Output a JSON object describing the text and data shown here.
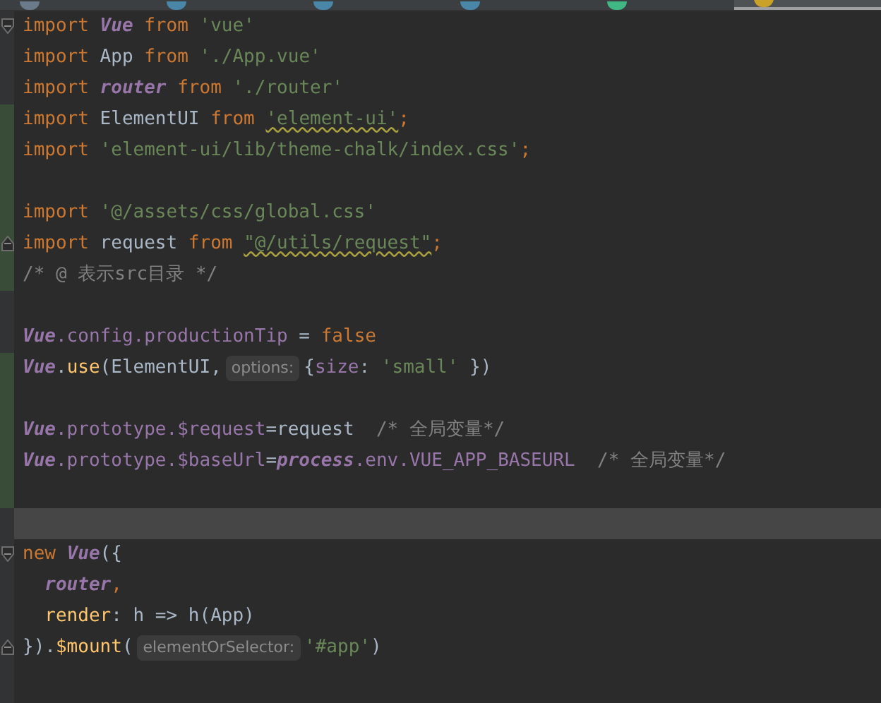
{
  "tabs": [
    {
      "kind": "file",
      "selected": false
    },
    {
      "kind": "java",
      "selected": false
    },
    {
      "kind": "java",
      "selected": false
    },
    {
      "kind": "java",
      "selected": false
    },
    {
      "kind": "vue",
      "selected": false
    },
    {
      "kind": "js",
      "selected": true
    }
  ],
  "lines": [
    {
      "kind": "fold-start",
      "changed": false,
      "current": false,
      "segs": [
        {
          "tokens": [
            {
              "t": "import ",
              "kind": "kw"
            },
            {
              "t": "Vue",
              "kind": "cls"
            },
            {
              "t": " from ",
              "kind": "kw"
            },
            {
              "t": "'vue'",
              "kind": "str"
            }
          ]
        }
      ]
    },
    {
      "kind": "plain",
      "changed": false,
      "current": false,
      "segs": [
        {
          "tokens": [
            {
              "t": "import ",
              "kind": "kw"
            },
            {
              "t": "App",
              "kind": "id"
            },
            {
              "t": " from ",
              "kind": "kw"
            },
            {
              "t": "'./App.vue'",
              "kind": "str"
            }
          ]
        }
      ]
    },
    {
      "kind": "plain",
      "changed": false,
      "current": false,
      "segs": [
        {
          "tokens": [
            {
              "t": "import ",
              "kind": "kw"
            },
            {
              "t": "router",
              "kind": "cls"
            },
            {
              "t": " from ",
              "kind": "kw"
            },
            {
              "t": "'./router'",
              "kind": "str"
            }
          ]
        }
      ]
    },
    {
      "kind": "plain",
      "changed": true,
      "current": false,
      "segs": [
        {
          "tokens": [
            {
              "t": "import ",
              "kind": "kw"
            },
            {
              "t": "ElementUI",
              "kind": "id"
            },
            {
              "t": " from ",
              "kind": "kw"
            },
            {
              "t": "'element-ui'",
              "kind": "warn"
            },
            {
              "t": ";",
              "kind": "kw"
            }
          ]
        }
      ]
    },
    {
      "kind": "plain",
      "changed": true,
      "current": false,
      "segs": [
        {
          "tokens": [
            {
              "t": "import ",
              "kind": "kw"
            },
            {
              "t": "'element-ui/lib/theme-chalk/index.css'",
              "kind": "str"
            },
            {
              "t": ";",
              "kind": "kw"
            }
          ]
        }
      ]
    },
    {
      "kind": "plain",
      "changed": true,
      "current": false
    },
    {
      "kind": "plain",
      "changed": true,
      "current": false,
      "segs": [
        {
          "tokens": [
            {
              "t": "import ",
              "kind": "kw"
            },
            {
              "t": "'@/assets/css/global.css'",
              "kind": "str"
            }
          ]
        }
      ]
    },
    {
      "kind": "fold-end",
      "changed": true,
      "current": false,
      "segs": [
        {
          "tokens": [
            {
              "t": "import ",
              "kind": "kw"
            },
            {
              "t": "request",
              "kind": "id"
            },
            {
              "t": " from ",
              "kind": "kw"
            },
            {
              "t": "\"@/utils/request\"",
              "kind": "warn"
            },
            {
              "t": ";",
              "kind": "kw"
            }
          ]
        }
      ]
    },
    {
      "kind": "plain",
      "changed": true,
      "current": false,
      "segs": [
        {
          "tokens": [
            {
              "t": "/* @ 表示src目录 */",
              "kind": "cmt"
            }
          ]
        }
      ]
    },
    {
      "kind": "plain",
      "changed": false,
      "current": false
    },
    {
      "kind": "plain",
      "changed": false,
      "current": false,
      "segs": [
        {
          "tokens": [
            {
              "t": "Vue",
              "kind": "cls"
            },
            {
              "t": ".config.productionTip",
              "kind": "prop"
            },
            {
              "t": " = ",
              "kind": "id"
            },
            {
              "t": "false",
              "kind": "kw"
            }
          ]
        }
      ]
    },
    {
      "kind": "plain",
      "changed": true,
      "current": false,
      "segs": [
        {
          "tokens": [
            {
              "t": "Vue",
              "kind": "cls"
            },
            {
              "t": ".",
              "kind": "id"
            },
            {
              "t": "use",
              "kind": "fn"
            },
            {
              "t": "(ElementUI,",
              "kind": "id"
            }
          ]
        },
        {
          "hint": "options:"
        },
        {
          "tokens": [
            {
              "t": "{",
              "kind": "id"
            },
            {
              "t": "size",
              "kind": "prop"
            },
            {
              "t": ": ",
              "kind": "id"
            },
            {
              "t": "'small'",
              "kind": "str"
            },
            {
              "t": " })",
              "kind": "id"
            }
          ]
        }
      ]
    },
    {
      "kind": "plain",
      "changed": true,
      "current": false
    },
    {
      "kind": "plain",
      "changed": true,
      "current": false,
      "segs": [
        {
          "tokens": [
            {
              "t": "Vue",
              "kind": "cls"
            },
            {
              "t": ".prototype.$request",
              "kind": "prop"
            },
            {
              "t": "=request  ",
              "kind": "id"
            },
            {
              "t": "/* 全局变量*/",
              "kind": "cmt"
            }
          ]
        }
      ]
    },
    {
      "kind": "plain",
      "changed": true,
      "current": false,
      "segs": [
        {
          "tokens": [
            {
              "t": "Vue",
              "kind": "cls"
            },
            {
              "t": ".prototype.$baseUrl",
              "kind": "prop"
            },
            {
              "t": "=",
              "kind": "id"
            },
            {
              "t": "process",
              "kind": "cls"
            },
            {
              "t": ".env.VUE_APP_BASEURL  ",
              "kind": "prop"
            },
            {
              "t": "/* 全局变量*/",
              "kind": "cmt"
            }
          ]
        }
      ]
    },
    {
      "kind": "plain",
      "changed": true,
      "current": false
    },
    {
      "kind": "plain",
      "changed": false,
      "current": true
    },
    {
      "kind": "fold-start",
      "changed": false,
      "current": false,
      "segs": [
        {
          "tokens": [
            {
              "t": "new ",
              "kind": "kw"
            },
            {
              "t": "Vue",
              "kind": "cls"
            },
            {
              "t": "({",
              "kind": "id"
            }
          ]
        }
      ]
    },
    {
      "kind": "plain",
      "changed": false,
      "current": false,
      "segs": [
        {
          "tokens": [
            {
              "t": "  router",
              "kind": "cls"
            },
            {
              "t": ",",
              "kind": "kw"
            }
          ]
        }
      ]
    },
    {
      "kind": "plain",
      "changed": false,
      "current": false,
      "segs": [
        {
          "tokens": [
            {
              "t": "  render",
              "kind": "fn"
            },
            {
              "t": ": h => h(App)",
              "kind": "id"
            }
          ]
        }
      ]
    },
    {
      "kind": "fold-end",
      "changed": false,
      "current": false,
      "segs": [
        {
          "tokens": [
            {
              "t": "}).",
              "kind": "id"
            },
            {
              "t": "$mount",
              "kind": "fn"
            },
            {
              "t": "(",
              "kind": "id"
            }
          ]
        },
        {
          "hint": "elementOrSelector:"
        },
        {
          "tokens": [
            {
              "t": "'#app'",
              "kind": "str"
            },
            {
              "t": ")",
              "kind": "id"
            }
          ]
        }
      ]
    }
  ]
}
